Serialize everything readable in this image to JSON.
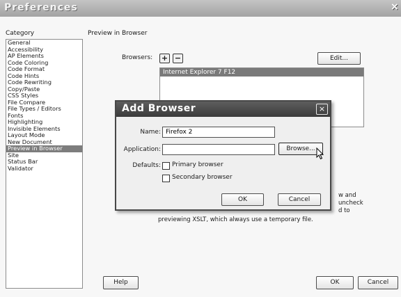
{
  "window": {
    "title": "Preferences",
    "close_glyph": "×"
  },
  "category": {
    "label": "Category",
    "items": [
      "General",
      "Accessibility",
      "AP Elements",
      "Code Coloring",
      "Code Format",
      "Code Hints",
      "Code Rewriting",
      "Copy/Paste",
      "CSS Styles",
      "File Compare",
      "File Types / Editors",
      "Fonts",
      "Highlighting",
      "Invisible Elements",
      "Layout Mode",
      "New Document",
      "Preview in Browser",
      "Site",
      "Status Bar",
      "Validator"
    ],
    "selected_index": 16
  },
  "panel": {
    "title": "Preview in Browser",
    "browsers_label": "Browsers:",
    "add_glyph": "+",
    "remove_glyph": "−",
    "edit_label": "Edit...",
    "browser_entries": [
      "Internet Explorer 7   F12"
    ],
    "note_lines": [
      "w and",
      "uncheck",
      "d to",
      "previewing XSLT, which always use a temporary file."
    ]
  },
  "footer": {
    "help_label": "Help",
    "ok_label": "OK",
    "cancel_label": "Cancel"
  },
  "dialog": {
    "title": "Add Browser",
    "close_glyph": "×",
    "name_label": "Name:",
    "name_value": "Firefox 2",
    "application_label": "Application:",
    "application_value": "",
    "browse_label": "Browse...",
    "defaults_label": "Defaults:",
    "primary_label": "Primary browser",
    "secondary_label": "Secondary browser",
    "primary_checked": false,
    "secondary_checked": false,
    "ok_label": "OK",
    "cancel_label": "Cancel"
  }
}
